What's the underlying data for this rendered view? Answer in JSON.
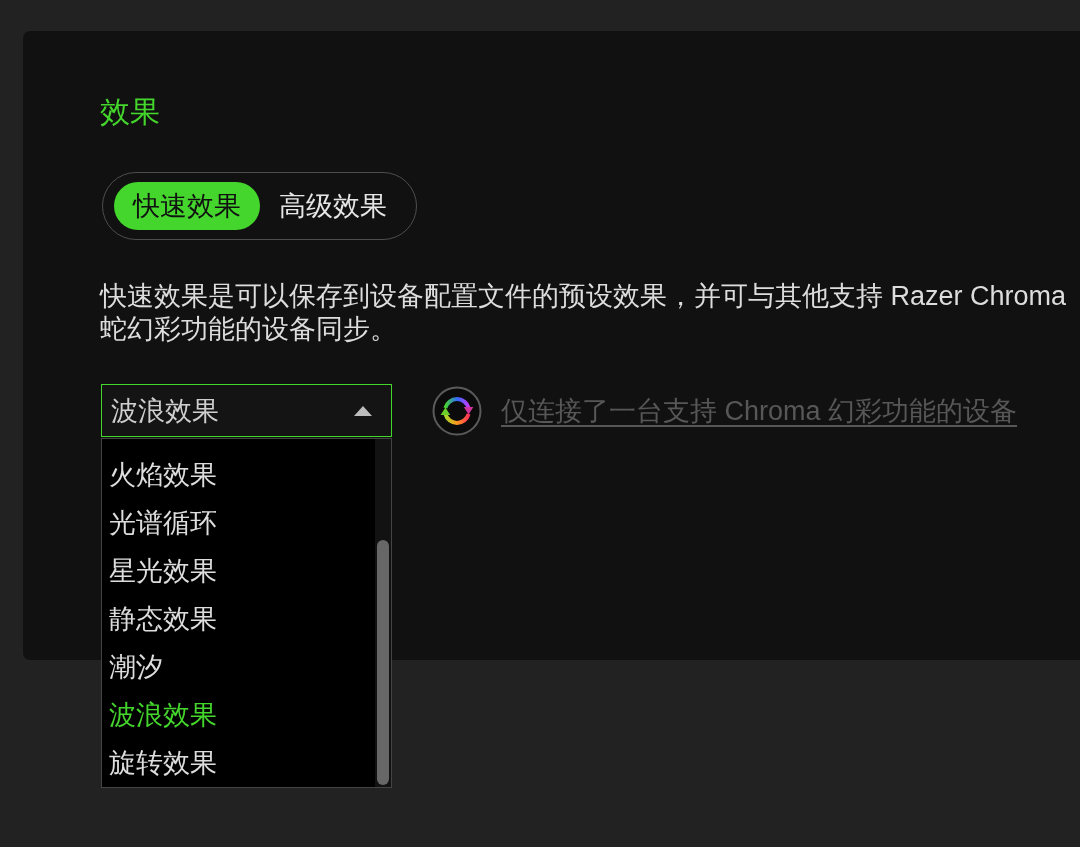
{
  "section": {
    "title": "效果"
  },
  "mode_tabs": [
    {
      "label": "快速效果",
      "selected": true
    },
    {
      "label": "高级效果",
      "selected": false
    }
  ],
  "description_lines": [
    "快速效果是可以保存到设备配置文件的预设效果，并可与其他支持 Razer Chroma",
    "蛇幻彩功能的设备同步。"
  ],
  "effect_dropdown": {
    "value": "波浪效果",
    "expanded": true,
    "options": [
      {
        "label": "火焰效果",
        "selected": false
      },
      {
        "label": "光谱循环",
        "selected": false
      },
      {
        "label": "星光效果",
        "selected": false
      },
      {
        "label": "静态效果",
        "selected": false
      },
      {
        "label": "潮汐",
        "selected": false
      },
      {
        "label": "波浪效果",
        "selected": true
      },
      {
        "label": "旋转效果",
        "selected": false
      }
    ]
  },
  "chroma_link": {
    "text": "仅连接了一台支持 Chroma 幻彩功能的设备"
  }
}
